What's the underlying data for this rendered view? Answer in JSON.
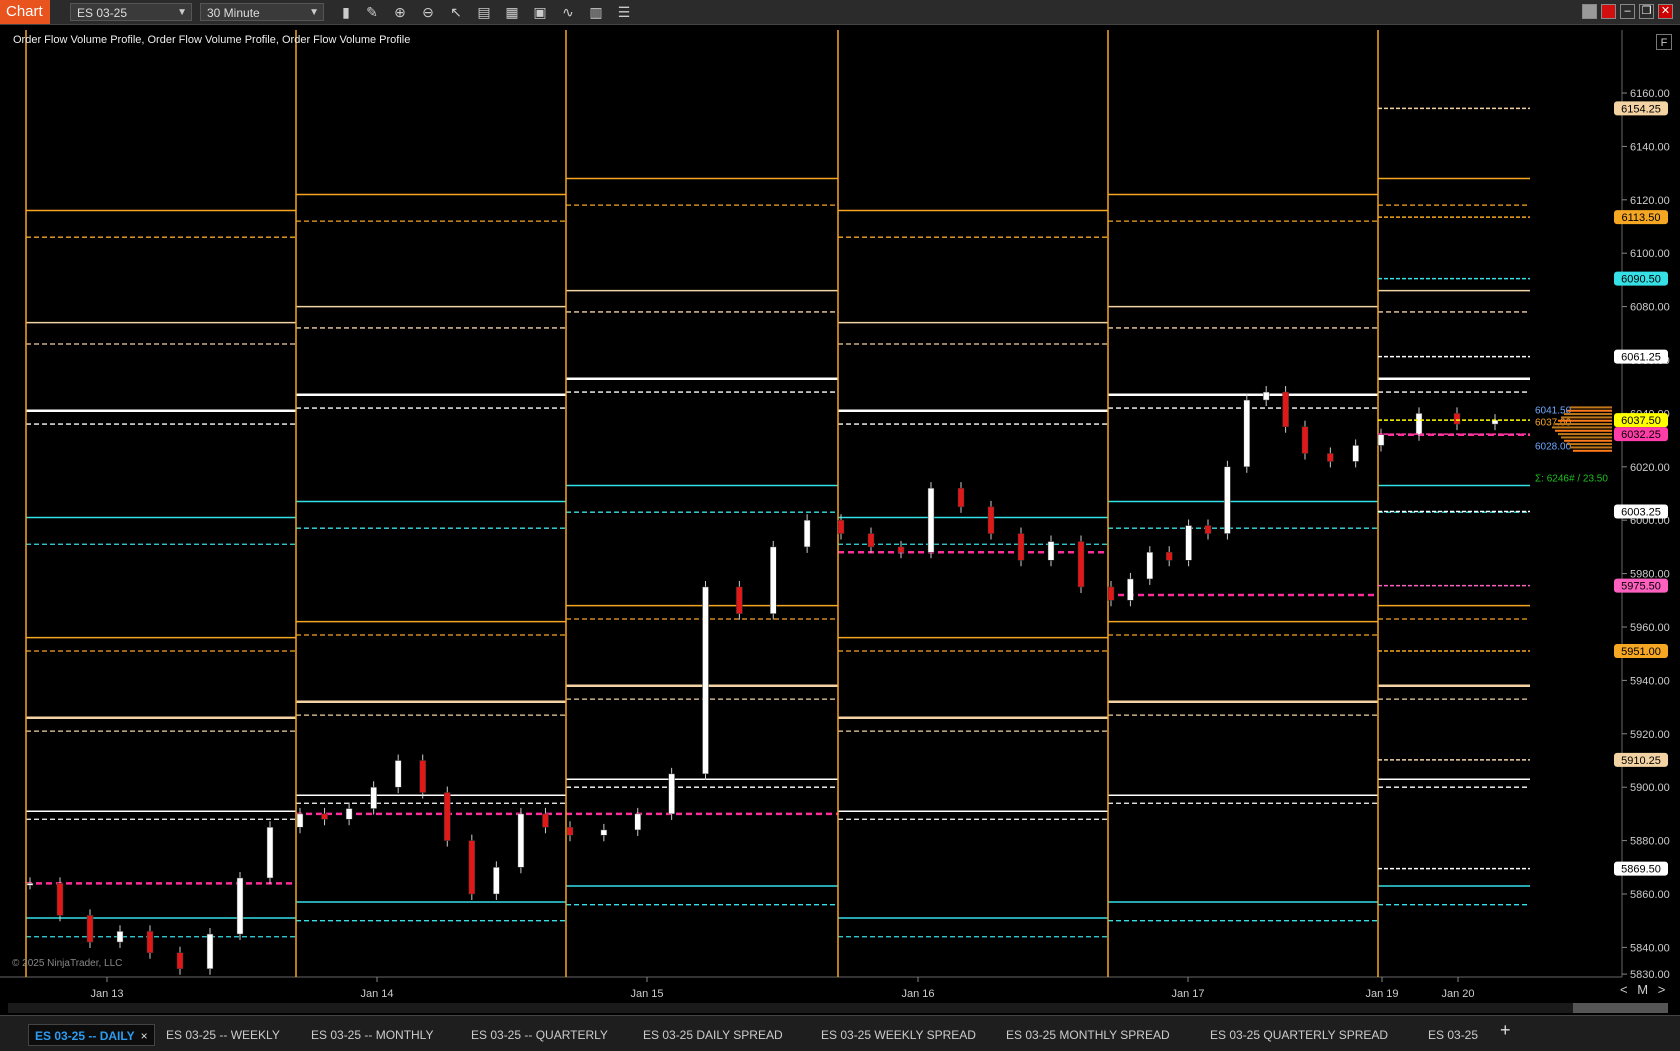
{
  "app": {
    "title": "Chart"
  },
  "toolbar": {
    "instrument": "ES 03-25",
    "interval": "30 Minute",
    "icons": [
      "bar-type-icon",
      "pencil-icon",
      "zoom-in-icon",
      "zoom-out-icon",
      "pointer-icon",
      "data-box-icon",
      "properties-icon",
      "strategy-icon",
      "indicators-icon",
      "chart-trader-icon",
      "list-icon"
    ]
  },
  "chart": {
    "indicator_label": "Order Flow Volume Profile, Order Flow Volume Profile, Order Flow Volume Profile",
    "copyright": "© 2025 NinjaTrader, LLC",
    "f_button": "F"
  },
  "chart_data": {
    "type": "line",
    "instrument": "ES 03-25",
    "y_ticks": [
      6160,
      6140,
      6120,
      6100,
      6080,
      6060,
      6040,
      6020,
      6000,
      5980,
      5960,
      5940,
      5920,
      5900,
      5880,
      5860,
      5840,
      5830
    ],
    "y_tick_labels": [
      "6160.00",
      "6140.00",
      "6120.00",
      "6100.00",
      "6080.00",
      "6060.00",
      "6040.00",
      "6020.00",
      "6000.00",
      "5980.00",
      "5960.00",
      "5940.00",
      "5920.00",
      "5900.00",
      "5880.00",
      "5860.00",
      "5840.00",
      "5830.00"
    ],
    "x_labels": [
      "Jan 13",
      "Jan 14",
      "Jan 15",
      "Jan 16",
      "Jan 17",
      "Jan 19",
      "Jan 20"
    ],
    "price_markers": [
      {
        "label": "6154.25",
        "value": 6154.25,
        "color": "#f3d3a3"
      },
      {
        "label": "6113.50",
        "value": 6113.5,
        "color": "#f5a623"
      },
      {
        "label": "6090.50",
        "value": 6090.5,
        "color": "#35e0e6"
      },
      {
        "label": "6061.25",
        "value": 6061.25,
        "color": "#ffffff"
      },
      {
        "label": "6037.50",
        "value": 6037.5,
        "color": "#ffff00"
      },
      {
        "label": "6032.25",
        "value": 6032.25,
        "color": "#ff3da8"
      },
      {
        "label": "6003.25",
        "value": 6003.25,
        "color": "#ffffff"
      },
      {
        "label": "5975.50",
        "value": 5975.5,
        "color": "#ff5fbf"
      },
      {
        "label": "5951.00",
        "value": 5951.0,
        "color": "#f5a623"
      },
      {
        "label": "5910.25",
        "value": 5910.25,
        "color": "#f3d3a3"
      },
      {
        "label": "5869.50",
        "value": 5869.5,
        "color": "#ffffff"
      }
    ],
    "profile_labels": [
      {
        "label": "6041.50",
        "value": 6041.5,
        "color": "#6fa8ff"
      },
      {
        "label": "6037.00",
        "value": 6037.0,
        "color": "#f5a623"
      },
      {
        "label": "6028.00",
        "value": 6028.0,
        "color": "#6fa8ff"
      }
    ],
    "volume_summary": "Σ: 6246# / 23.50",
    "close_path": [
      [
        "Jan 13",
        5864
      ],
      [
        "Jan 13",
        5852
      ],
      [
        "Jan 13",
        5842
      ],
      [
        "Jan 13",
        5846
      ],
      [
        "Jan 13",
        5838
      ],
      [
        "Jan 13",
        5832
      ],
      [
        "Jan 13",
        5845
      ],
      [
        "Jan 13",
        5866
      ],
      [
        "Jan 13",
        5885
      ],
      [
        "Jan 14",
        5890
      ],
      [
        "Jan 14",
        5888
      ],
      [
        "Jan 14",
        5892
      ],
      [
        "Jan 14",
        5900
      ],
      [
        "Jan 14",
        5910
      ],
      [
        "Jan 14",
        5898
      ],
      [
        "Jan 14",
        5880
      ],
      [
        "Jan 14",
        5860
      ],
      [
        "Jan 14",
        5870
      ],
      [
        "Jan 14",
        5890
      ],
      [
        "Jan 14",
        5885
      ],
      [
        "Jan 15",
        5882
      ],
      [
        "Jan 15",
        5884
      ],
      [
        "Jan 15",
        5890
      ],
      [
        "Jan 15",
        5905
      ],
      [
        "Jan 15",
        5975
      ],
      [
        "Jan 15",
        5965
      ],
      [
        "Jan 15",
        5990
      ],
      [
        "Jan 15",
        6000
      ],
      [
        "Jan 16",
        5995
      ],
      [
        "Jan 16",
        5990
      ],
      [
        "Jan 16",
        5988
      ],
      [
        "Jan 16",
        6012
      ],
      [
        "Jan 16",
        6005
      ],
      [
        "Jan 16",
        5995
      ],
      [
        "Jan 16",
        5985
      ],
      [
        "Jan 16",
        5992
      ],
      [
        "Jan 16",
        5975
      ],
      [
        "Jan 17",
        5970
      ],
      [
        "Jan 17",
        5978
      ],
      [
        "Jan 17",
        5988
      ],
      [
        "Jan 17",
        5985
      ],
      [
        "Jan 17",
        5998
      ],
      [
        "Jan 17",
        5995
      ],
      [
        "Jan 17",
        6020
      ],
      [
        "Jan 17",
        6045
      ],
      [
        "Jan 17",
        6048
      ],
      [
        "Jan 17",
        6035
      ],
      [
        "Jan 19",
        6025
      ],
      [
        "Jan 19",
        6022
      ],
      [
        "Jan 19",
        6028
      ],
      [
        "Jan 20",
        6032
      ],
      [
        "Jan 20",
        6040
      ],
      [
        "Jan 20",
        6036
      ],
      [
        "Jan 20",
        6037.5
      ]
    ]
  },
  "tabs": [
    {
      "label": "ES 03-25 -- DAILY",
      "active": true,
      "close": "×"
    },
    {
      "label": "ES 03-25 -- WEEKLY"
    },
    {
      "label": "ES 03-25 -- MONTHLY"
    },
    {
      "label": "ES 03-25 -- QUARTERLY"
    },
    {
      "label": "ES 03-25 DAILY SPREAD"
    },
    {
      "label": "ES 03-25 WEEKLY SPREAD"
    },
    {
      "label": "ES 03-25 MONTHLY SPREAD"
    },
    {
      "label": "ES 03-25 QUARTERLY SPREAD"
    },
    {
      "label": "ES 03-25"
    }
  ],
  "nav": {
    "prev": "<",
    "mode": "M",
    "next": ">",
    "add": "+"
  }
}
